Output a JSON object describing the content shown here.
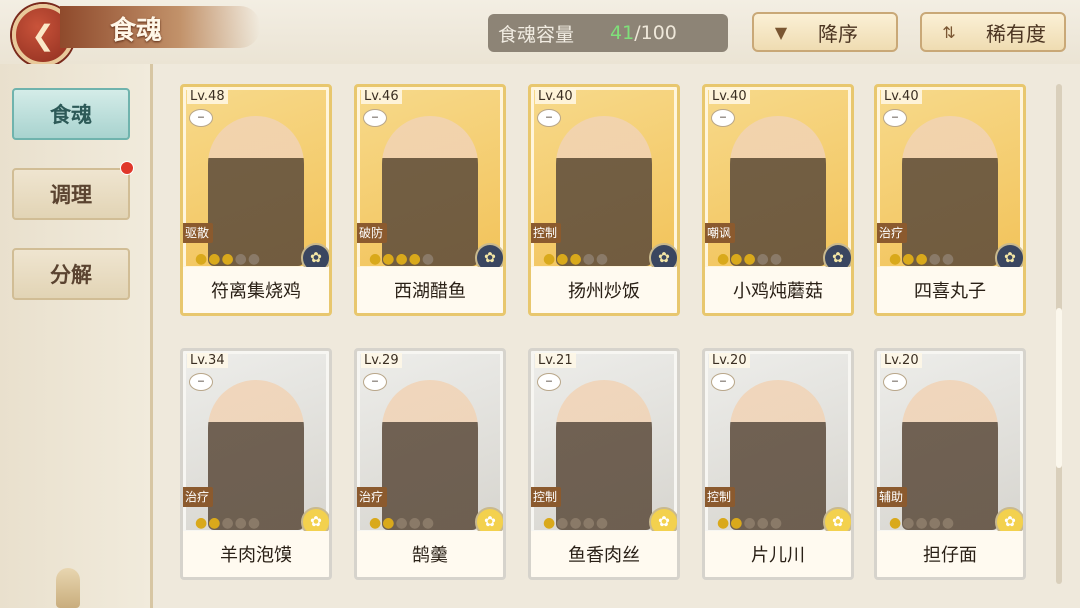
{
  "header": {
    "back_icon": "chevron-left-icon",
    "title": "食魂",
    "capacity_label": "食魂容量",
    "capacity_current": "41",
    "capacity_max": "/100",
    "sort_button": "降序",
    "filter_button": "稀有度"
  },
  "sidebar": {
    "tabs": [
      {
        "label": "食魂",
        "active": true
      },
      {
        "label": "调理",
        "active": false,
        "notification": true
      },
      {
        "label": "分解",
        "active": false
      }
    ]
  },
  "cards": [
    {
      "level": "Lv.48",
      "role": "驱散",
      "name": "符离集烧鸡",
      "stars": 3,
      "rarity": "gold"
    },
    {
      "level": "Lv.46",
      "role": "破防",
      "name": "西湖醋鱼",
      "stars": 4,
      "rarity": "gold"
    },
    {
      "level": "Lv.40",
      "role": "控制",
      "name": "扬州炒饭",
      "stars": 3,
      "rarity": "gold"
    },
    {
      "level": "Lv.40",
      "role": "嘲讽",
      "name": "小鸡炖蘑菇",
      "stars": 3,
      "rarity": "gold"
    },
    {
      "level": "Lv.40",
      "role": "治疗",
      "name": "四喜丸子",
      "stars": 3,
      "rarity": "gold"
    },
    {
      "level": "Lv.34",
      "role": "治疗",
      "name": "羊肉泡馍",
      "stars": 2,
      "rarity": "silver"
    },
    {
      "level": "Lv.29",
      "role": "治疗",
      "name": "鹄羹",
      "stars": 2,
      "rarity": "silver"
    },
    {
      "level": "Lv.21",
      "role": "控制",
      "name": "鱼香肉丝",
      "stars": 1,
      "rarity": "silver"
    },
    {
      "level": "Lv.20",
      "role": "控制",
      "name": "片儿川",
      "stars": 2,
      "rarity": "silver"
    },
    {
      "level": "Lv.20",
      "role": "辅助",
      "name": "担仔面",
      "stars": 1,
      "rarity": "silver"
    }
  ]
}
